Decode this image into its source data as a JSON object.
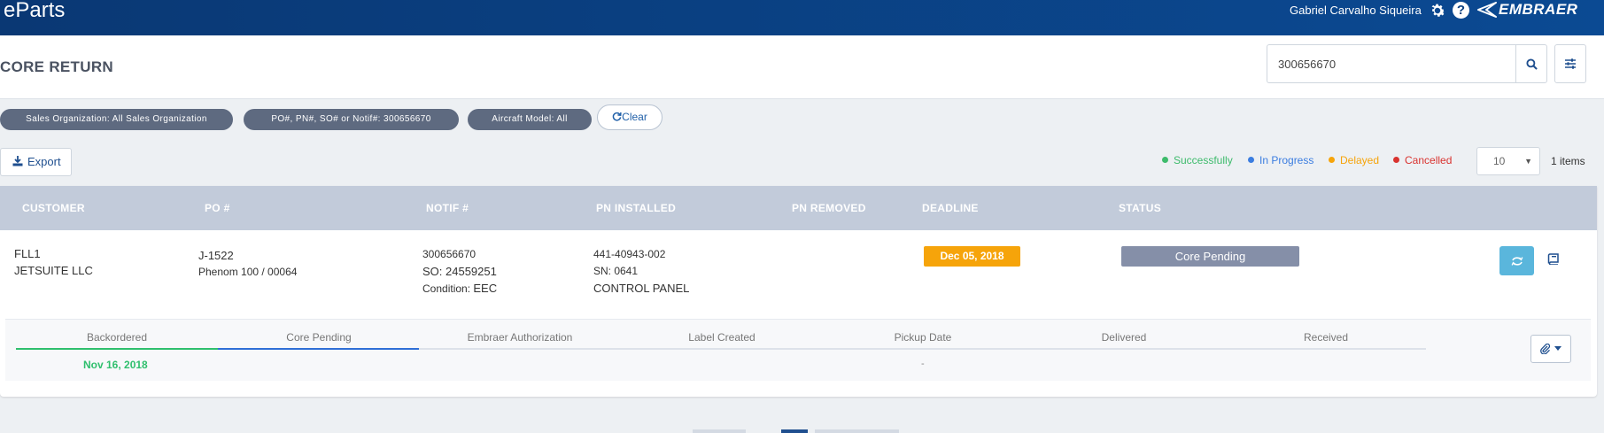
{
  "topbar": {
    "brand": "eParts",
    "user_name": "Gabriel Carvalho Siqueira",
    "help_glyph": "?",
    "logo_text": "EMBRAER",
    "icons": [
      "gear-icon",
      "help-icon",
      "embraer-logo"
    ]
  },
  "header": {
    "title": "CORE RETURN",
    "search_value": "300656670",
    "icons": [
      "search-icon",
      "sliders-icon"
    ]
  },
  "filters": {
    "chips": [
      "Sales Organization: All Sales Organization",
      "PO#, PN#, SO# or Notif#: 300656670",
      "Aircraft Model: All"
    ],
    "clear_label": "Clear"
  },
  "toolbar": {
    "export_label": "Export",
    "legend": [
      {
        "label": "Successfully",
        "color": "#3dbb6b"
      },
      {
        "label": "In Progress",
        "color": "#3b7de0"
      },
      {
        "label": "Delayed",
        "color": "#f6a40a"
      },
      {
        "label": "Cancelled",
        "color": "#d9332f"
      }
    ],
    "page_size": "10",
    "items_count": "1 items"
  },
  "table": {
    "headers": [
      "CUSTOMER",
      "PO #",
      "NOTIF #",
      "PN INSTALLED",
      "PN REMOVED",
      "DEADLINE",
      "STATUS"
    ],
    "rows": [
      {
        "customer_code": "FLL1",
        "customer_name": "JETSUITE LLC",
        "po": "J-1522",
        "aircraft": "Phenom 100 / 00064",
        "notif": "300656670",
        "so": "SO: 24559251",
        "condition_label": "Condition:",
        "condition_value": "EEC",
        "pn_installed": "441-40943-002",
        "sn": "SN: 0641",
        "part_desc": "CONTROL PANEL",
        "pn_removed": "",
        "deadline": "Dec 05, 2018",
        "status": "Core Pending",
        "tracking": {
          "steps": [
            "Backordered",
            "Core Pending",
            "Embraer Authorization",
            "Label Created",
            "Pickup Date",
            "Delivered",
            "Received"
          ],
          "backordered_date": "Nov 16, 2018",
          "pickup_date": "-"
        }
      }
    ]
  },
  "colors": {
    "topbar": "#0b4080",
    "deadline_delayed": "#f6a40a",
    "status_badge": "#858fa8",
    "success": "#2fbf6d",
    "in_progress": "#2f6fd6",
    "action_button": "#5ab6dc"
  }
}
